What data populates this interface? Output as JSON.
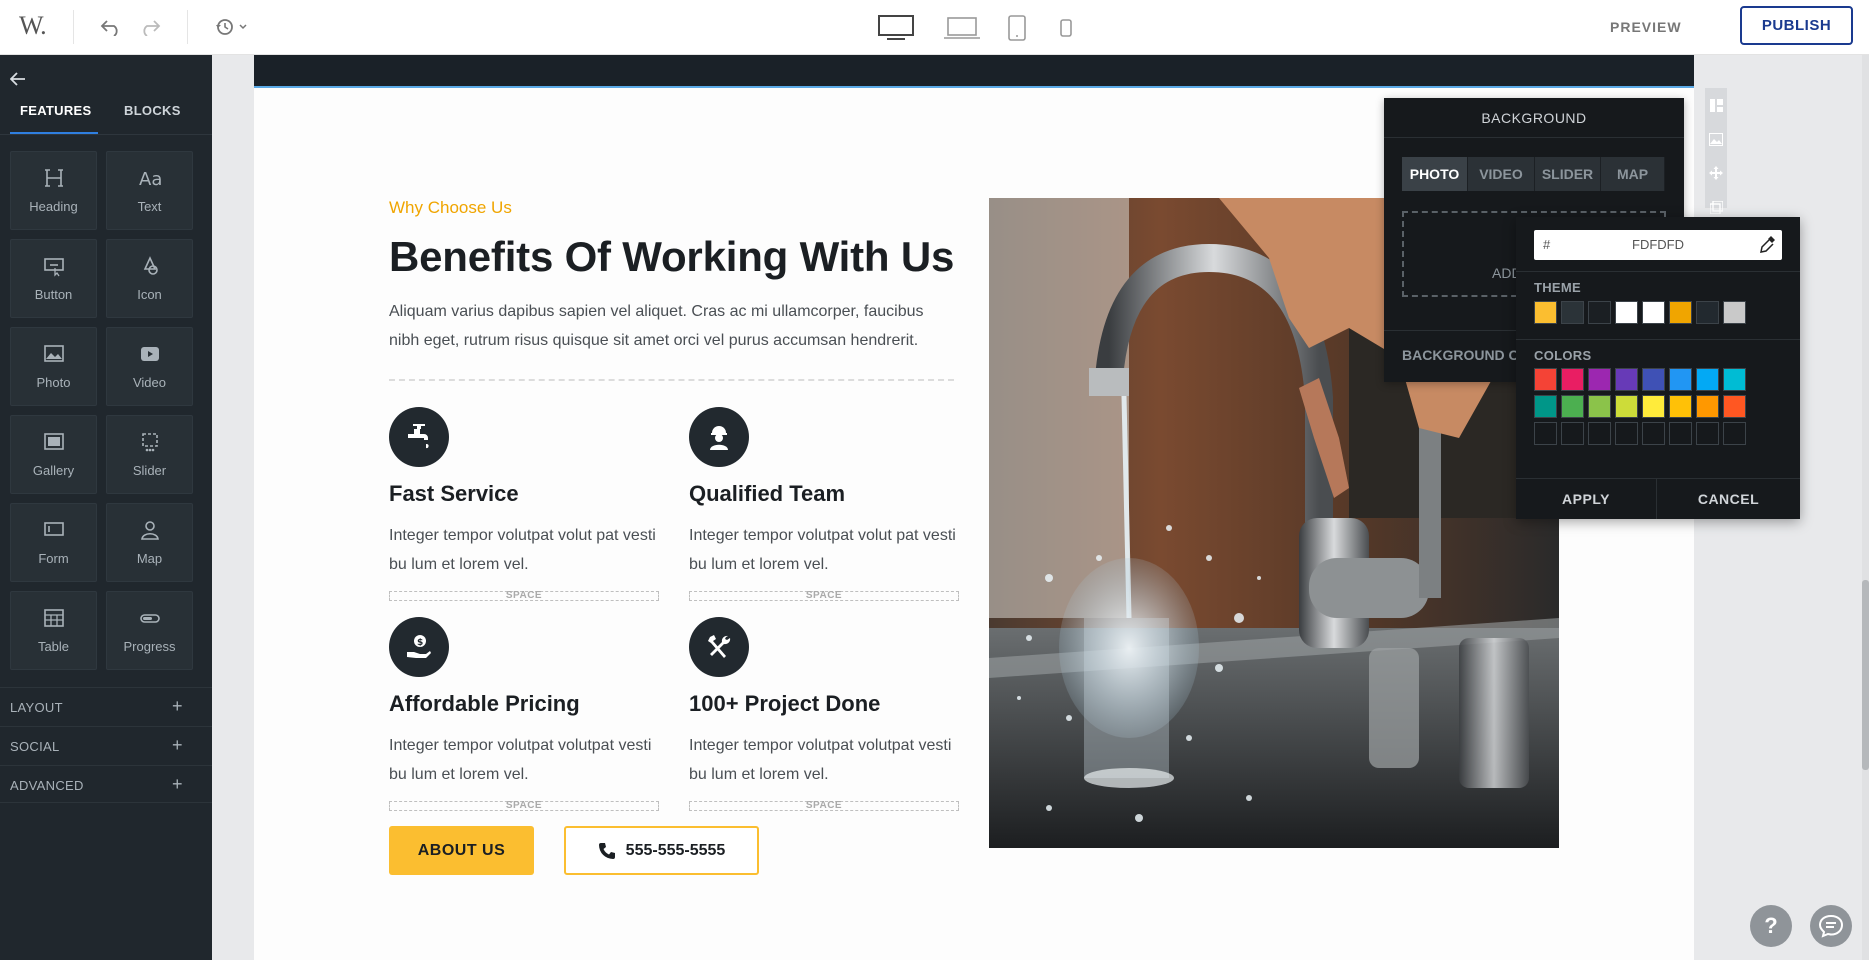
{
  "topbar": {
    "logo": "W.",
    "preview_label": "PREVIEW",
    "publish_label": "PUBLISH"
  },
  "sidebar": {
    "tabs": [
      "FEATURES",
      "BLOCKS"
    ],
    "active_tab": "FEATURES",
    "tiles": [
      {
        "label": "Heading",
        "icon": "heading-icon"
      },
      {
        "label": "Text",
        "icon": "text-icon"
      },
      {
        "label": "Button",
        "icon": "button-icon"
      },
      {
        "label": "Icon",
        "icon": "icon-icon"
      },
      {
        "label": "Photo",
        "icon": "photo-icon"
      },
      {
        "label": "Video",
        "icon": "video-icon"
      },
      {
        "label": "Gallery",
        "icon": "gallery-icon"
      },
      {
        "label": "Slider",
        "icon": "slider-icon"
      },
      {
        "label": "Form",
        "icon": "form-icon"
      },
      {
        "label": "Map",
        "icon": "map-icon"
      },
      {
        "label": "Table",
        "icon": "table-icon"
      },
      {
        "label": "Progress",
        "icon": "progress-icon"
      }
    ],
    "sections": [
      {
        "label": "LAYOUT",
        "toggle": "+"
      },
      {
        "label": "SOCIAL",
        "toggle": "+"
      },
      {
        "label": "ADVANCED",
        "toggle": "+"
      }
    ]
  },
  "page": {
    "eyebrow": "Why Choose Us",
    "title": "Benefits Of Working With Us",
    "intro": "Aliquam varius dapibus sapien vel aliquet. Cras ac mi ullamcorper, faucibus nibh eget, rutrum risus quisque sit amet orci vel purus accumsan hendrerit.",
    "features": [
      {
        "title": "Fast Service",
        "text": "Integer tempor volutpat volut pat vesti bu lum et lorem vel.",
        "icon": "faucet-icon"
      },
      {
        "title": "Qualified Team",
        "text": "Integer tempor volutpat volut pat vesti bu lum et lorem vel.",
        "icon": "worker-icon"
      },
      {
        "title": "Affordable Pricing",
        "text": "Integer tempor volutpat volutpat vesti bu lum et lorem vel.",
        "icon": "money-hand-icon"
      },
      {
        "title": "100+ Project Done",
        "text": "Integer tempor volutpat volutpat vesti bu lum et lorem vel.",
        "icon": "tools-icon"
      }
    ],
    "space_label": "SPACE",
    "about_button": "ABOUT US",
    "phone_button": "555-555-5555"
  },
  "background_panel": {
    "title": "BACKGROUND",
    "tabs": [
      "PHOTO",
      "VIDEO",
      "SLIDER",
      "MAP"
    ],
    "active_tab": "PHOTO",
    "drop_label": "ADD",
    "color_label": "BACKGROUND C"
  },
  "color_picker": {
    "hash": "#",
    "hex_value": "FDFDFD",
    "theme_label": "THEME",
    "colors_label": "COLORS",
    "theme_swatches": [
      "#fbbe30",
      "#2b3338",
      "#1b1f23",
      "#ffffff",
      "#ffffff",
      "#f0a500",
      "#22292f",
      "#c9c9c9"
    ],
    "color_swatches_row1": [
      "#f44336",
      "#e91e63",
      "#9c27b0",
      "#673ab7",
      "#3f51b5",
      "#2196f3",
      "#03a9f4",
      "#00bcd4"
    ],
    "color_swatches_row2": [
      "#009688",
      "#4caf50",
      "#8bc34a",
      "#cddc39",
      "#ffeb3b",
      "#ffc107",
      "#ff9800",
      "#ff5722"
    ],
    "apply_label": "APPLY",
    "cancel_label": "CANCEL"
  },
  "help": {
    "label": "?"
  }
}
